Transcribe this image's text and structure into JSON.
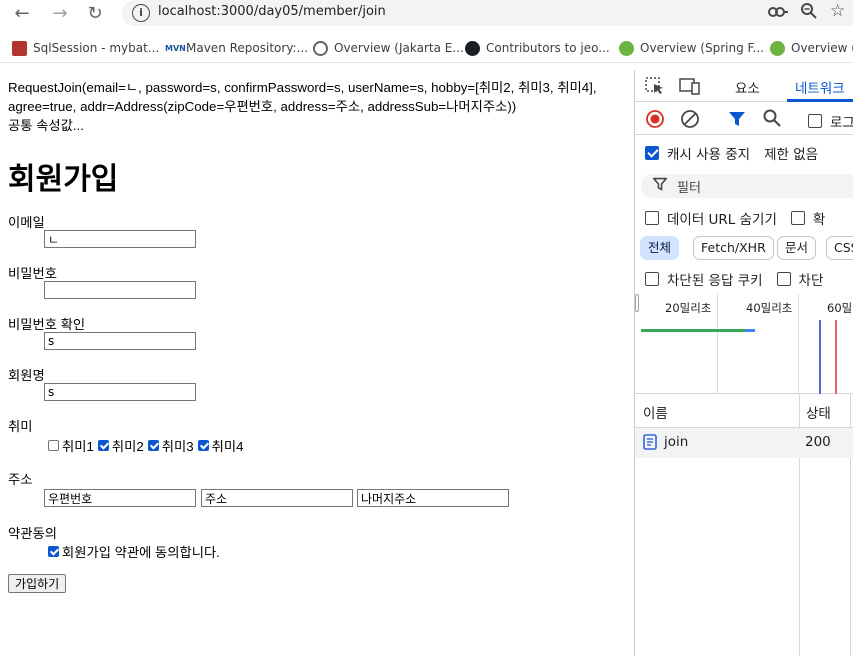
{
  "browser": {
    "url": "localhost:3000/day05/member/join",
    "bookmarks": [
      {
        "label": "SqlSession - mybat...",
        "icon": "sql"
      },
      {
        "label": "Maven Repository:...",
        "icon": "mvn"
      },
      {
        "label": "Overview (Jakarta E...",
        "icon": "globe"
      },
      {
        "label": "Contributors to jeo...",
        "icon": "github"
      },
      {
        "label": "Overview (Spring F...",
        "icon": "spring"
      },
      {
        "label": "Overview (S",
        "icon": "spring"
      }
    ],
    "mvn_badge": "MVN"
  },
  "page": {
    "debug_line": "RequestJoin(email=ㄴ, password=s, confirmPassword=s, userName=s, hobby=[취미2, 취미3, 취미4], agree=true, addr=Address(zipCode=우편번호, address=주소, addressSub=나머지주소))",
    "common_text": "공통 속성값...",
    "title": "회원가입",
    "email": {
      "label": "이메일",
      "value": "ㄴ"
    },
    "password": {
      "label": "비밀번호",
      "value": ""
    },
    "confirm_password": {
      "label": "비밀번호 확인",
      "value": "s"
    },
    "user_name": {
      "label": "회원명",
      "value": "s"
    },
    "hobby": {
      "label": "취미",
      "options": [
        {
          "label": "취미1",
          "checked": false
        },
        {
          "label": "취미2",
          "checked": true
        },
        {
          "label": "취미3",
          "checked": true
        },
        {
          "label": "취미4",
          "checked": true
        }
      ]
    },
    "address": {
      "label": "주소",
      "zip_code": "우편번호",
      "address": "주소",
      "address_sub": "나머지주소"
    },
    "agree": {
      "label": "약관동의",
      "checkbox_label": "회원가입 약관에 동의합니다.",
      "checked": true
    },
    "submit_label": "가입하기"
  },
  "devtools": {
    "tabs": [
      "요소",
      "네트워크"
    ],
    "disable_cache": "캐시 사용 중지",
    "throttling": "제한 없음",
    "filter_placeholder": "필터",
    "hide_data_urls": "데이터 URL 숨기기",
    "hide_ext": "확",
    "chips": [
      "전체",
      "Fetch/XHR",
      "문서",
      "CSS"
    ],
    "blocked_cookies": "차단된 응답 쿠키",
    "blocked_requests": "차단",
    "preserve_log": "로그",
    "timeline": [
      "20밀리초",
      "40밀리초",
      "60밀"
    ],
    "columns": {
      "name": "이름",
      "status": "상태"
    },
    "request": {
      "name": "join",
      "status": "200"
    }
  }
}
